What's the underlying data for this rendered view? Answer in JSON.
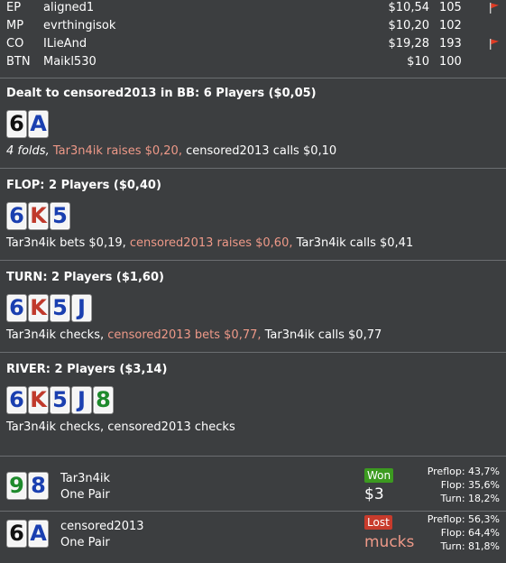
{
  "colors": {
    "background": "#3c3e40",
    "card_face": "#f5f5f5",
    "suit_spade": "#111111",
    "suit_diamond": "#1a3fb0",
    "suit_heart": "#c0392b",
    "suit_club": "#1e8a2c",
    "highlight_action": "#ee9988",
    "won_badge": "#3c9a20",
    "lost_badge": "#c83b2c"
  },
  "players": [
    {
      "pos": "EP",
      "name": "aligned1",
      "stack": "$10,54",
      "bb": "105",
      "flag": true
    },
    {
      "pos": "MP",
      "name": "evrthingisok",
      "stack": "$10,20",
      "bb": "102",
      "flag": false
    },
    {
      "pos": "CO",
      "name": "ILieAnd",
      "stack": "$19,28",
      "bb": "193",
      "flag": true
    },
    {
      "pos": "BTN",
      "name": "Maikl530",
      "stack": "$10",
      "bb": "100",
      "flag": false
    }
  ],
  "streets": [
    {
      "heading": "Dealt to censored2013 in BB: 6 Players ($0,05)",
      "cards": [
        {
          "rank": "6",
          "suit": "spade"
        },
        {
          "rank": "A",
          "suit": "diamond"
        }
      ],
      "actions": [
        {
          "text": "4 folds, ",
          "italic": true,
          "highlight": false
        },
        {
          "text": "Tar3n4ik raises $0,20, ",
          "italic": false,
          "highlight": true
        },
        {
          "text": "censored2013 calls $0,10",
          "italic": false,
          "highlight": false
        }
      ]
    },
    {
      "heading": "FLOP: 2 Players ($0,40)",
      "cards": [
        {
          "rank": "6",
          "suit": "diamond"
        },
        {
          "rank": "K",
          "suit": "heart"
        },
        {
          "rank": "5",
          "suit": "diamond"
        }
      ],
      "actions": [
        {
          "text": "Tar3n4ik bets $0,19, ",
          "italic": false,
          "highlight": false
        },
        {
          "text": "censored2013 raises $0,60, ",
          "italic": false,
          "highlight": true
        },
        {
          "text": "Tar3n4ik calls $0,41",
          "italic": false,
          "highlight": false
        }
      ]
    },
    {
      "heading": "TURN: 2 Players ($1,60)",
      "cards": [
        {
          "rank": "6",
          "suit": "diamond"
        },
        {
          "rank": "K",
          "suit": "heart"
        },
        {
          "rank": "5",
          "suit": "diamond"
        },
        {
          "rank": "J",
          "suit": "diamond"
        }
      ],
      "actions": [
        {
          "text": "Tar3n4ik checks, ",
          "italic": false,
          "highlight": false
        },
        {
          "text": "censored2013 bets $0,77, ",
          "italic": false,
          "highlight": true
        },
        {
          "text": "Tar3n4ik calls $0,77",
          "italic": false,
          "highlight": false
        }
      ]
    },
    {
      "heading": "RIVER: 2 Players ($3,14)",
      "cards": [
        {
          "rank": "6",
          "suit": "diamond"
        },
        {
          "rank": "K",
          "suit": "heart"
        },
        {
          "rank": "5",
          "suit": "diamond"
        },
        {
          "rank": "J",
          "suit": "diamond"
        },
        {
          "rank": "8",
          "suit": "club"
        }
      ],
      "actions": [
        {
          "text": "Tar3n4ik checks, censored2013 checks",
          "italic": false,
          "highlight": false
        }
      ]
    }
  ],
  "results": [
    {
      "cards": [
        {
          "rank": "9",
          "suit": "club"
        },
        {
          "rank": "8",
          "suit": "diamond"
        }
      ],
      "name": "Tar3n4ik",
      "hand": "One Pair",
      "badge": "Won",
      "won": true,
      "amount": "$3",
      "stats": {
        "preflop_label": "Preflop:",
        "preflop": "43,7%",
        "flop_label": "Flop:",
        "flop": "35,6%",
        "turn_label": "Turn:",
        "turn": "18,2%"
      }
    },
    {
      "cards": [
        {
          "rank": "6",
          "suit": "spade"
        },
        {
          "rank": "A",
          "suit": "diamond"
        }
      ],
      "name": "censored2013",
      "hand": "One Pair",
      "badge": "Lost",
      "won": false,
      "amount": "mucks",
      "stats": {
        "preflop_label": "Preflop:",
        "preflop": "56,3%",
        "flop_label": "Flop:",
        "flop": "64,4%",
        "turn_label": "Turn:",
        "turn": "81,8%"
      }
    }
  ]
}
